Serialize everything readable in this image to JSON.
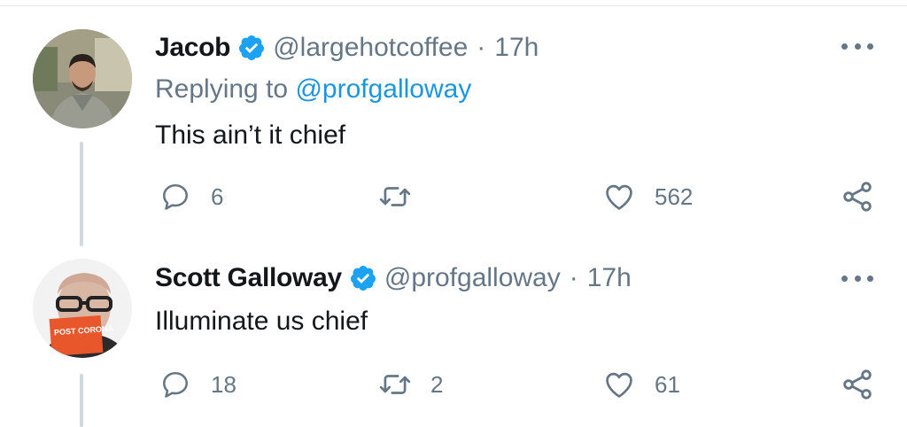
{
  "tweets": [
    {
      "display_name": "Jacob",
      "handle": "@largehotcoffee",
      "separator": "·",
      "time": "17h",
      "replying_prefix": "Replying to",
      "replying_to": "@profgalloway",
      "text": "This ain’t it chief",
      "reply_count": "6",
      "retweet_count": "",
      "like_count": "562",
      "verified": true
    },
    {
      "display_name": "Scott Galloway",
      "handle": "@profgalloway",
      "separator": "·",
      "time": "17h",
      "text": "Illuminate us chief",
      "reply_count": "18",
      "retweet_count": "2",
      "like_count": "61",
      "verified": true,
      "avatar_book_text": "POST CORONA"
    }
  ],
  "icons": {
    "verified": "verified-badge-icon",
    "reply": "reply-bubble-icon",
    "retweet": "retweet-icon",
    "like": "heart-icon",
    "share": "share-icon",
    "more": "more-options-icon"
  },
  "colors": {
    "verified": "#1da1f2",
    "link": "#1b95e0",
    "secondary_text": "#657786",
    "thread_line": "#cfd9de"
  }
}
